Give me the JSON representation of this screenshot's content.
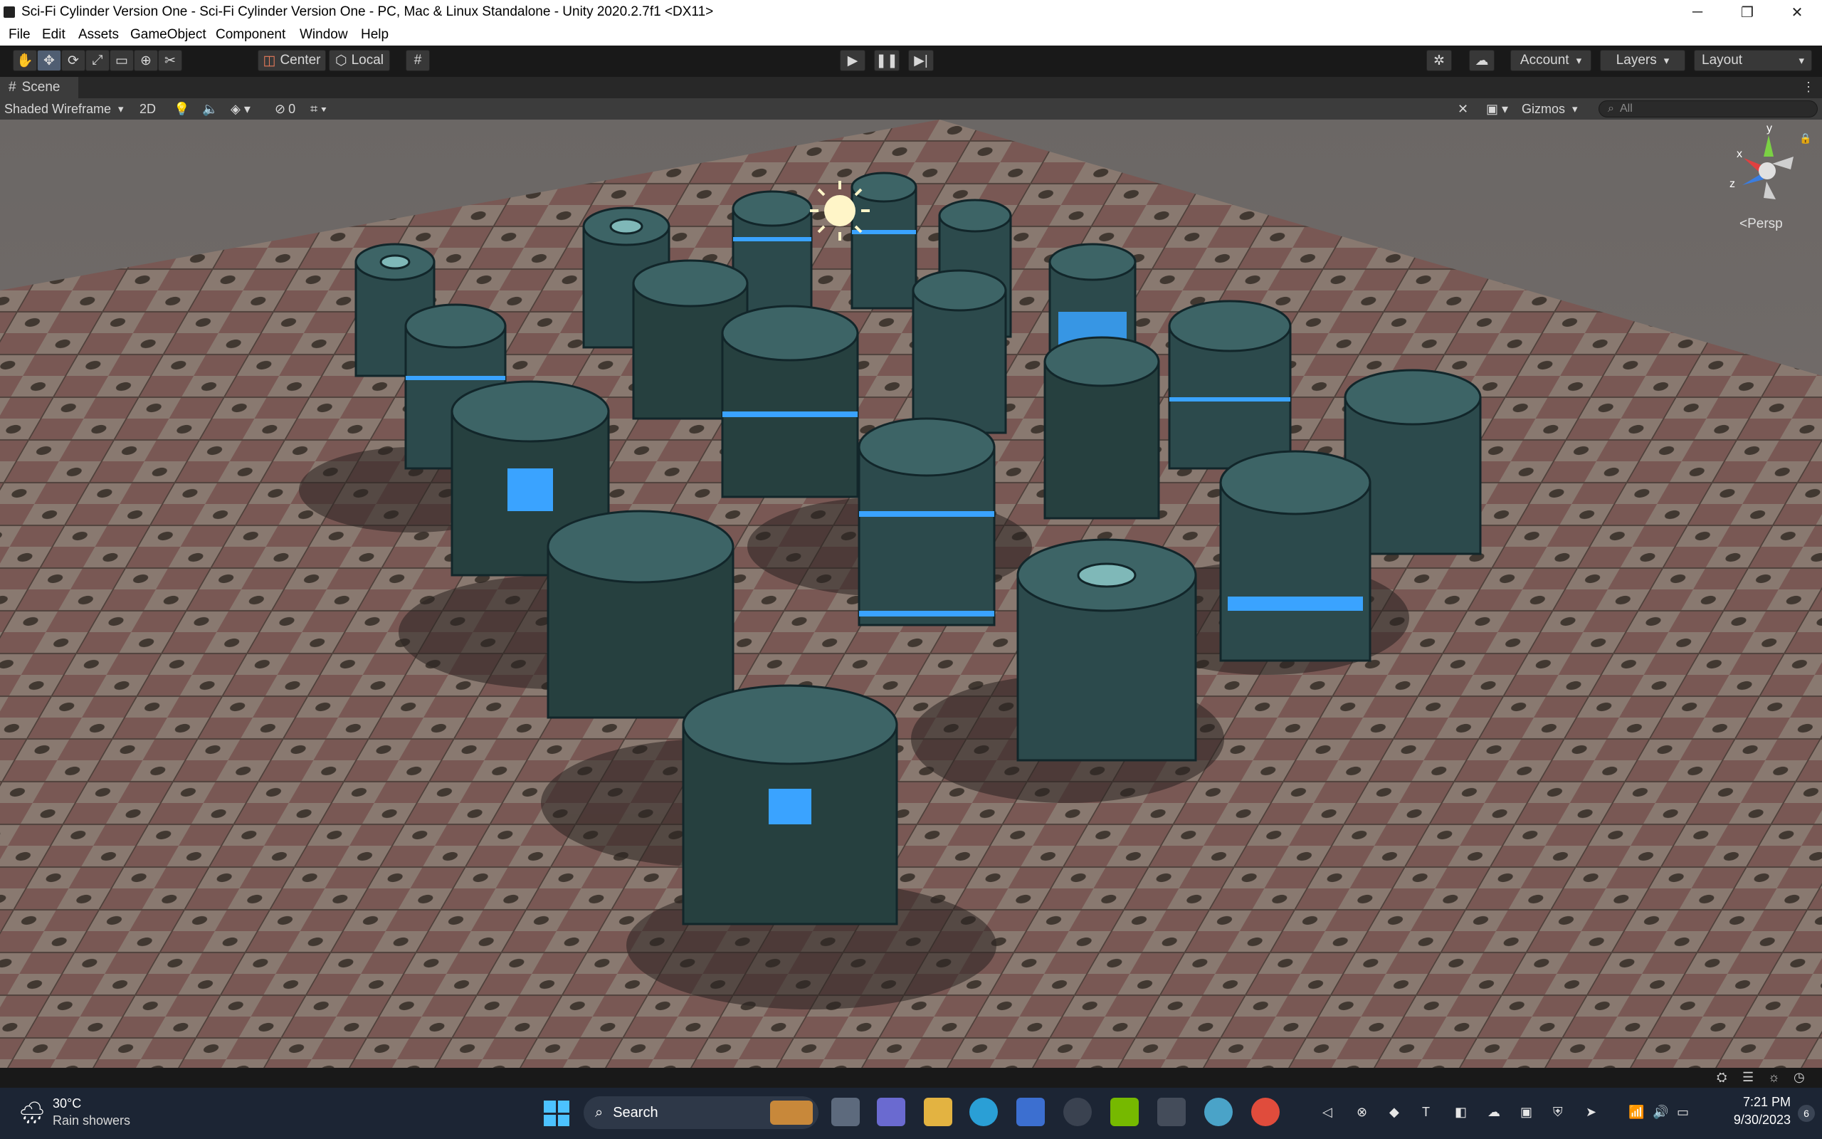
{
  "window": {
    "title": "Sci-Fi Cylinder Version One - Sci-Fi Cylinder Version One - PC, Mac & Linux Standalone - Unity 2020.2.7f1 <DX11>",
    "controls": [
      "minimize-icon",
      "restore-icon",
      "close-icon"
    ]
  },
  "menu": [
    "File",
    "Edit",
    "Assets",
    "GameObject",
    "Component",
    "Window",
    "Help"
  ],
  "toolbar": {
    "tools": [
      "hand-tool-icon",
      "move-tool-icon",
      "rotate-tool-icon",
      "scale-tool-icon",
      "rect-tool-icon",
      "transform-tool-icon",
      "custom-tool-icon"
    ],
    "pivot_label": "Center",
    "space_label": "Local",
    "account_label": "Account",
    "layers_label": "Layers",
    "layout_label": "Layout",
    "accent_color": "#505e72"
  },
  "scene_tab": {
    "label": "Scene"
  },
  "scene_toolbar": {
    "shading_mode": "Shaded Wireframe",
    "mode_2d": "2D",
    "hidden_count": "0",
    "gizmos_label": "Gizmos",
    "search_placeholder": "All"
  },
  "scene_view": {
    "projection_label": "Persp",
    "axes": {
      "x": "x",
      "y": "y",
      "z": "z"
    },
    "objects": "sci-fi cylinder prefabs on tiled floor"
  },
  "taskbar": {
    "weather_temp": "30°C",
    "weather_desc": "Rain showers",
    "search_label": "Search",
    "time": "7:21 PM",
    "date": "9/30/2023",
    "notification_count": "6"
  }
}
